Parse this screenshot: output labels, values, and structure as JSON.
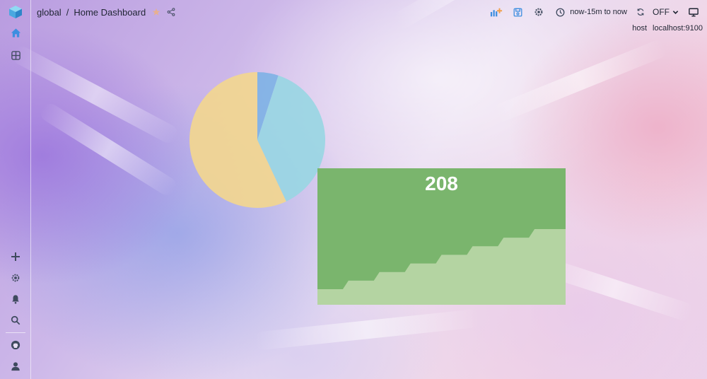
{
  "breadcrumb": {
    "folder": "global",
    "separator": "/",
    "dashboard": "Home Dashboard"
  },
  "time_range": {
    "label": "now-15m to now"
  },
  "refresh": {
    "label": "OFF"
  },
  "variables": [
    {
      "name": "host",
      "value": "localhost:9100"
    }
  ],
  "icons": {
    "logo": "logo-cube-icon",
    "home": "home-icon",
    "dashboards": "dashboards-icon",
    "add": "plus-icon",
    "config": "gear-icon",
    "alerts": "bell-icon",
    "search": "search-icon",
    "github": "github-icon",
    "profile": "user-icon"
  },
  "colors": {
    "stat_background": "#7ab56d",
    "sparkline_fill": "#b4d4a2",
    "pie_yellow": "#f2d68f",
    "pie_cyan": "#99d6e3",
    "pie_blue": "#7fb2e5"
  },
  "stat_panel": {
    "value": "208",
    "sparkline": [
      {
        "x": 0,
        "y": 1
      },
      {
        "x": 1,
        "y": 2
      },
      {
        "x": 2,
        "y": 3
      },
      {
        "x": 3,
        "y": 4
      },
      {
        "x": 4,
        "y": 5
      },
      {
        "x": 5,
        "y": 6
      },
      {
        "x": 6,
        "y": 7
      },
      {
        "x": 7,
        "y": 8
      }
    ]
  },
  "chart_data": {
    "type": "pie",
    "slices": [
      {
        "value": 5,
        "color": "#7fb2e5"
      },
      {
        "value": 38,
        "color": "#99d6e3"
      },
      {
        "value": 57,
        "color": "#f2d68f"
      }
    ]
  }
}
